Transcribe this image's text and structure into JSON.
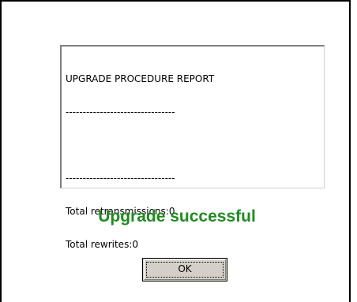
{
  "report": {
    "lines": [
      "UPGRADE PROCEDURE REPORT",
      "--------------------------------",
      "",
      "--------------------------------",
      "Total retransmissions:0",
      "Total rewrites:0"
    ]
  },
  "status": {
    "message": "Upgrade successful",
    "color": "#218a21"
  },
  "buttons": {
    "ok_label": "OK"
  }
}
